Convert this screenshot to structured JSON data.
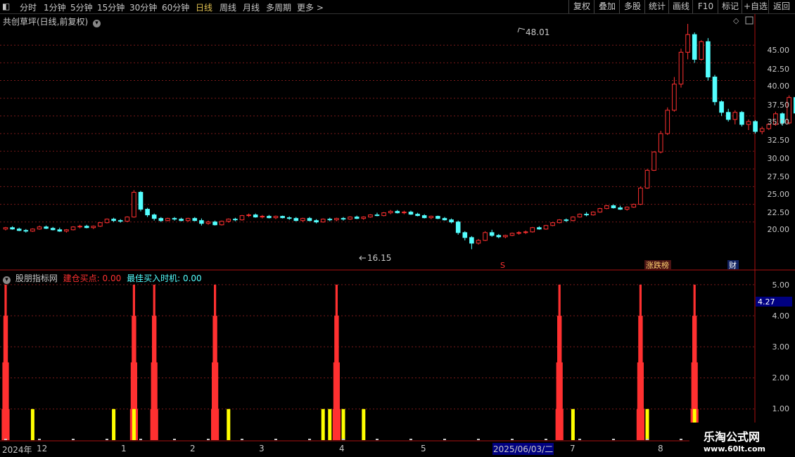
{
  "toolbar": {
    "back_glyph": "◧",
    "periods": [
      "分时",
      "1分钟",
      "5分钟",
      "15分钟",
      "30分钟",
      "60分钟",
      "日线",
      "周线",
      "月线",
      "多周期",
      "更多 >"
    ],
    "active_period": "日线",
    "right_buttons": [
      "复权",
      "叠加",
      "多股",
      "统计",
      "画线",
      "F10",
      "标记",
      "+自选",
      "返回"
    ]
  },
  "main_pane": {
    "stock_title": "共创草坪(日线,前复权)",
    "max_label": "48.01",
    "min_label": "16.15",
    "y_ticks": [
      "45.00",
      "42.50",
      "40.00",
      "37.50",
      "35.00",
      "32.50",
      "30.00",
      "27.50",
      "25.00",
      "22.50",
      "20.00"
    ],
    "markers": {
      "s": "S",
      "zdb": "涨跌榜",
      "cai": "财"
    }
  },
  "indicator_pane": {
    "name": "股朋指标网",
    "line1_label": "建仓买点:",
    "line1_value": "0.00",
    "line2_label": "最佳买入时机:",
    "line2_value": "0.00",
    "y_ticks": [
      "5.00",
      "4.00",
      "3.00",
      "2.00",
      "1.00"
    ],
    "cursor_value": "4.27"
  },
  "time_axis": {
    "labels": [
      "2024年",
      "12",
      "1",
      "2",
      "3",
      "4",
      "5",
      "2025/06/03/二",
      "7",
      "8"
    ]
  },
  "watermark": {
    "line1": "乐淘公式网",
    "line2": "www.60lt.com"
  },
  "colors": {
    "up": "#ff3030",
    "down": "#54ffff",
    "yellow": "#ffff00",
    "grid": "#7a1a1a",
    "active": "#e0c050"
  },
  "chart_data": {
    "type": "candlestick",
    "candles": [
      [
        19.0,
        19.3,
        18.8,
        19.2
      ],
      [
        19.2,
        19.4,
        18.9,
        19.0
      ],
      [
        19.0,
        19.2,
        18.7,
        18.8
      ],
      [
        18.8,
        19.0,
        18.5,
        18.7
      ],
      [
        18.7,
        19.1,
        18.6,
        19.0
      ],
      [
        19.0,
        19.5,
        18.9,
        19.3
      ],
      [
        19.3,
        19.5,
        19.0,
        19.1
      ],
      [
        19.1,
        19.3,
        18.8,
        18.9
      ],
      [
        18.9,
        19.2,
        18.6,
        18.7
      ],
      [
        18.7,
        19.0,
        18.5,
        18.9
      ],
      [
        18.9,
        19.4,
        18.8,
        19.3
      ],
      [
        19.3,
        19.6,
        19.1,
        19.4
      ],
      [
        19.4,
        19.6,
        19.1,
        19.2
      ],
      [
        19.2,
        19.5,
        19.0,
        19.4
      ],
      [
        19.4,
        20.0,
        19.3,
        19.9
      ],
      [
        19.9,
        20.5,
        19.8,
        20.4
      ],
      [
        20.4,
        20.6,
        20.0,
        20.2
      ],
      [
        20.2,
        20.4,
        19.9,
        20.1
      ],
      [
        20.1,
        20.8,
        20.0,
        20.7
      ],
      [
        20.7,
        24.5,
        20.6,
        24.2
      ],
      [
        24.2,
        24.4,
        21.5,
        21.8
      ],
      [
        21.8,
        22.0,
        20.7,
        21.0
      ],
      [
        21.0,
        21.2,
        20.2,
        20.5
      ],
      [
        20.5,
        20.7,
        20.0,
        20.2
      ],
      [
        20.2,
        20.6,
        20.1,
        20.5
      ],
      [
        20.5,
        20.7,
        20.2,
        20.4
      ],
      [
        20.4,
        20.6,
        20.1,
        20.2
      ],
      [
        20.2,
        20.6,
        20.0,
        20.5
      ],
      [
        20.5,
        20.7,
        20.1,
        20.2
      ],
      [
        20.2,
        20.5,
        19.5,
        19.8
      ],
      [
        19.8,
        20.2,
        19.6,
        20.0
      ],
      [
        20.0,
        20.2,
        19.5,
        19.6
      ],
      [
        19.6,
        20.2,
        19.5,
        20.1
      ],
      [
        20.1,
        20.5,
        19.9,
        20.4
      ],
      [
        20.4,
        20.6,
        20.1,
        20.3
      ],
      [
        20.3,
        21.0,
        20.2,
        20.9
      ],
      [
        20.9,
        21.2,
        20.7,
        21.0
      ],
      [
        21.0,
        21.2,
        20.6,
        20.7
      ],
      [
        20.7,
        21.0,
        20.5,
        20.8
      ],
      [
        20.8,
        21.0,
        20.5,
        20.6
      ],
      [
        20.6,
        20.9,
        20.4,
        20.8
      ],
      [
        20.8,
        20.9,
        20.5,
        20.6
      ],
      [
        20.6,
        20.8,
        20.3,
        20.5
      ],
      [
        20.5,
        20.7,
        20.1,
        20.2
      ],
      [
        20.2,
        20.6,
        20.0,
        20.5
      ],
      [
        20.5,
        20.7,
        20.1,
        20.2
      ],
      [
        20.2,
        20.4,
        19.8,
        20.0
      ],
      [
        20.0,
        20.5,
        19.9,
        20.4
      ],
      [
        20.4,
        20.6,
        20.1,
        20.3
      ],
      [
        20.3,
        20.6,
        20.1,
        20.5
      ],
      [
        20.5,
        20.7,
        20.2,
        20.4
      ],
      [
        20.4,
        20.8,
        20.3,
        20.7
      ],
      [
        20.7,
        20.9,
        20.4,
        20.5
      ],
      [
        20.5,
        20.8,
        20.3,
        20.7
      ],
      [
        20.7,
        21.1,
        20.6,
        21.0
      ],
      [
        21.0,
        21.3,
        20.8,
        20.9
      ],
      [
        20.9,
        21.4,
        20.8,
        21.3
      ],
      [
        21.3,
        21.7,
        21.1,
        21.5
      ],
      [
        21.5,
        21.7,
        21.2,
        21.3
      ],
      [
        21.3,
        21.6,
        21.1,
        21.4
      ],
      [
        21.4,
        21.6,
        21.0,
        21.1
      ],
      [
        21.1,
        21.3,
        20.8,
        20.9
      ],
      [
        20.9,
        21.1,
        20.5,
        20.6
      ],
      [
        20.6,
        20.9,
        20.4,
        20.8
      ],
      [
        20.8,
        20.9,
        20.4,
        20.5
      ],
      [
        20.5,
        20.7,
        20.2,
        20.3
      ],
      [
        20.3,
        20.5,
        19.8,
        20.0
      ],
      [
        20.0,
        20.2,
        18.2,
        18.5
      ],
      [
        18.5,
        18.7,
        17.4,
        17.8
      ],
      [
        17.8,
        18.0,
        16.15,
        17.0
      ],
      [
        17.0,
        17.6,
        16.8,
        17.4
      ],
      [
        17.4,
        18.7,
        17.3,
        18.5
      ],
      [
        18.5,
        18.9,
        17.9,
        18.1
      ],
      [
        18.1,
        18.3,
        17.7,
        17.9
      ],
      [
        17.9,
        18.2,
        17.7,
        18.1
      ],
      [
        18.1,
        18.5,
        18.0,
        18.4
      ],
      [
        18.4,
        18.7,
        18.2,
        18.5
      ],
      [
        18.5,
        18.8,
        18.3,
        18.6
      ],
      [
        18.6,
        19.3,
        18.5,
        19.2
      ],
      [
        19.2,
        19.4,
        18.9,
        19.0
      ],
      [
        19.0,
        19.6,
        18.9,
        19.5
      ],
      [
        19.5,
        20.0,
        19.4,
        19.9
      ],
      [
        19.9,
        20.4,
        19.8,
        20.3
      ],
      [
        20.3,
        20.5,
        20.0,
        20.2
      ],
      [
        20.2,
        20.8,
        20.1,
        20.7
      ],
      [
        20.7,
        21.2,
        20.6,
        21.1
      ],
      [
        21.1,
        21.4,
        20.8,
        21.0
      ],
      [
        21.0,
        21.5,
        20.9,
        21.4
      ],
      [
        21.4,
        22.0,
        21.3,
        21.9
      ],
      [
        21.9,
        22.4,
        21.8,
        22.3
      ],
      [
        22.3,
        22.5,
        21.9,
        22.0
      ],
      [
        22.0,
        22.3,
        21.7,
        21.8
      ],
      [
        21.8,
        22.2,
        21.6,
        22.1
      ],
      [
        22.1,
        22.6,
        22.0,
        22.5
      ],
      [
        22.5,
        25.0,
        22.4,
        24.8
      ],
      [
        24.8,
        27.5,
        24.7,
        27.3
      ],
      [
        27.3,
        30.0,
        27.2,
        29.9
      ],
      [
        29.9,
        32.9,
        29.7,
        32.5
      ],
      [
        32.5,
        36.2,
        32.3,
        35.8
      ],
      [
        35.8,
        40.5,
        35.6,
        39.5
      ],
      [
        39.5,
        44.5,
        39.0,
        44.0
      ],
      [
        44.0,
        48.01,
        43.0,
        46.5
      ],
      [
        46.5,
        46.8,
        42.5,
        43.0
      ],
      [
        43.0,
        45.7,
        42.8,
        45.5
      ],
      [
        45.5,
        46.0,
        40.0,
        40.5
      ],
      [
        40.5,
        40.8,
        36.5,
        37.0
      ],
      [
        37.0,
        37.2,
        35.0,
        35.5
      ],
      [
        35.5,
        36.0,
        34.2,
        34.5
      ],
      [
        34.5,
        35.8,
        33.8,
        35.5
      ],
      [
        35.5,
        35.7,
        33.5,
        33.8
      ],
      [
        33.8,
        34.5,
        33.0,
        34.2
      ],
      [
        34.2,
        34.4,
        32.5,
        32.8
      ],
      [
        32.8,
        33.5,
        32.4,
        33.2
      ],
      [
        33.2,
        34.0,
        33.0,
        33.8
      ],
      [
        33.8,
        35.6,
        33.6,
        35.3
      ],
      [
        35.3,
        35.5,
        33.6,
        34.0
      ],
      [
        34.0,
        37.9,
        33.8,
        37.6
      ],
      [
        37.6,
        37.8,
        35.0,
        35.4
      ],
      [
        35.4,
        35.6,
        33.8,
        34.2
      ],
      [
        34.2,
        34.4,
        33.3,
        33.6
      ],
      [
        33.6,
        34.2,
        33.2,
        34.0
      ],
      [
        34.0,
        34.2,
        33.0,
        33.3
      ],
      [
        33.3,
        33.9,
        33.1,
        33.7
      ],
      [
        33.7,
        33.9,
        32.5,
        32.7
      ],
      [
        32.7,
        33.0,
        32.0,
        32.2
      ],
      [
        32.2,
        32.5,
        31.8,
        32.0
      ],
      [
        32.0,
        32.6,
        31.9,
        32.5
      ],
      [
        32.5,
        35.2,
        32.4,
        35.0
      ],
      [
        35.0,
        38.5,
        34.8,
        38.2
      ],
      [
        38.2,
        41.8,
        36.5,
        37.0
      ],
      [
        37.0,
        37.2,
        35.0,
        35.5
      ],
      [
        35.5,
        35.8,
        32.5,
        33.0
      ],
      [
        33.0,
        33.2,
        31.8,
        32.0
      ],
      [
        32.0,
        32.3,
        31.3,
        31.6
      ],
      [
        31.6,
        31.8,
        30.6,
        30.8
      ],
      [
        30.8,
        31.4,
        30.7,
        31.2
      ],
      [
        31.2,
        31.5,
        30.8,
        31.0
      ],
      [
        31.0,
        31.6,
        30.9,
        31.4
      ],
      [
        31.4,
        32.1,
        31.3,
        31.9
      ],
      [
        31.9,
        32.2,
        31.4,
        31.6
      ],
      [
        31.6,
        32.3,
        31.5,
        32.1
      ],
      [
        32.1,
        32.7,
        32.0,
        32.5
      ],
      [
        32.5,
        33.1,
        32.3,
        32.8
      ],
      [
        32.8,
        33.0,
        32.2,
        32.4
      ],
      [
        32.4,
        33.1,
        32.3,
        32.9
      ],
      [
        32.9,
        33.0,
        31.5,
        31.8
      ],
      [
        31.8,
        33.4,
        31.7,
        33.2
      ],
      [
        33.2,
        33.3,
        31.8,
        32.0
      ]
    ],
    "ylim": [
      15.2,
      49.4
    ],
    "indicator": {
      "red_spikes": [
        0,
        19,
        22,
        31,
        49,
        82,
        94,
        102
      ],
      "yellow_bars": [
        4,
        16,
        19,
        33,
        47,
        48,
        50,
        53,
        84,
        95,
        102
      ],
      "ylim": [
        0,
        5.2
      ]
    }
  }
}
